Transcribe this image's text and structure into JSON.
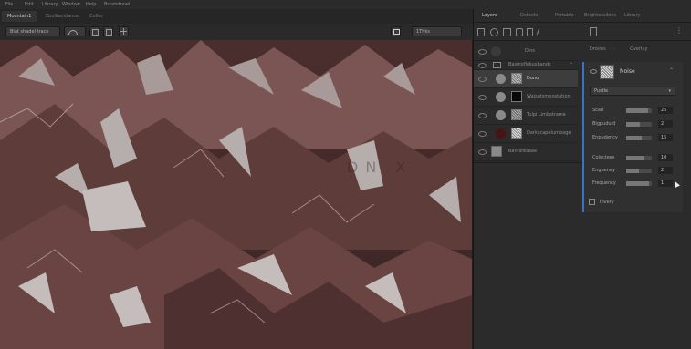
{
  "menu": [
    "File",
    "Edit",
    "Library",
    "Window",
    "Help",
    "Brushdrawl"
  ],
  "document_tabs": [
    "Mountain1",
    "Ebulkacidance",
    "Collec"
  ],
  "toolbar": {
    "brush_preset": "Blat shadel trace",
    "zoom_select": "1Thks"
  },
  "panel_tabs": [
    "Layers",
    "Detects",
    "Portable",
    "Brightessibles",
    "Library"
  ],
  "layers_toolbar_label": "Dins",
  "layer_group_label": "Basinoflakusbands",
  "layers": [
    {
      "name": "Dono",
      "selected": true
    },
    {
      "name": "Wajsutsmnostation",
      "selected": false
    },
    {
      "name": "Tulpi Limbstrame",
      "selected": false
    },
    {
      "name": "Darkscapelumbage",
      "selected": false
    },
    {
      "name": "Bantsreasae",
      "selected": false
    }
  ],
  "props_header": {
    "tab1": "Droons",
    "tab2": "Overlay"
  },
  "props_title": "Noise",
  "props_dropdown": "Pustle",
  "properties": [
    {
      "label": "Scalt",
      "value": "25",
      "fill": 0.85
    },
    {
      "label": "Bigpuduld",
      "value": "2",
      "fill": 0.55
    },
    {
      "label": "Enpudency",
      "value": "15",
      "fill": 0.6
    },
    {
      "label": "Colectees",
      "value": "10",
      "fill": 0.7
    },
    {
      "label": "Enguenay",
      "value": "2",
      "fill": 0.5
    },
    {
      "label": "Frequency",
      "value": "1",
      "fill": 0.9
    }
  ],
  "checkbox_label": "Invery",
  "canvas_watermark": "DN X"
}
